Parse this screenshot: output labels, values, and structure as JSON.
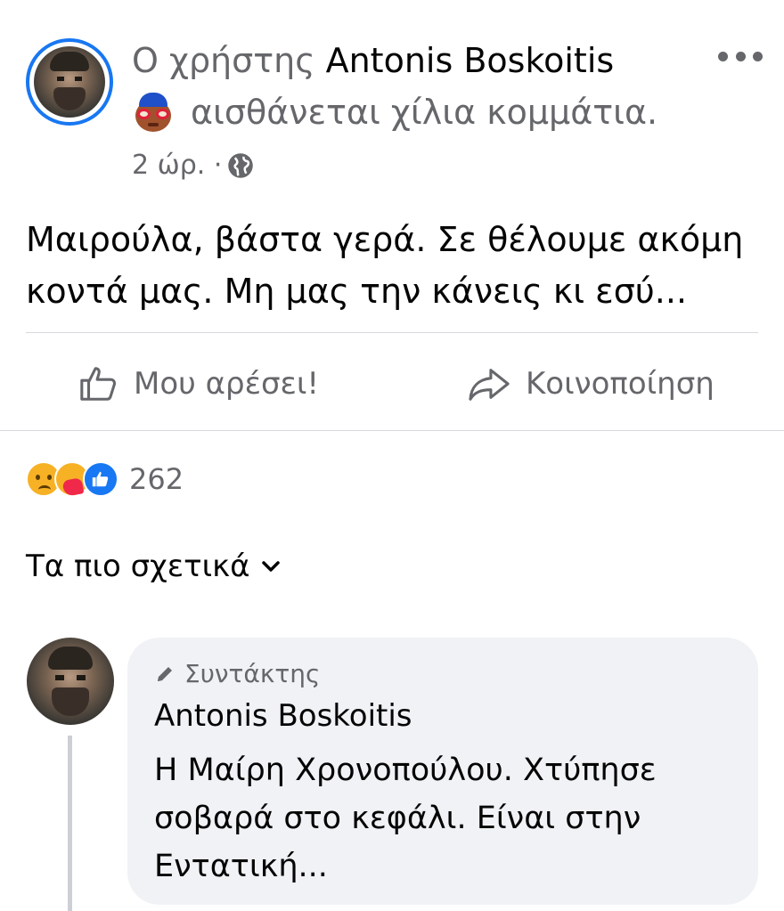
{
  "post": {
    "status_prefix": "Ο χρήστης",
    "author": "Antonis Boskoitis",
    "feeling_emoji": "nerd-with-cap-emoji",
    "feeling_text": "αισθάνεται χίλια κομμάτια.",
    "time": "2 ώρ. ·",
    "privacy_icon": "globe-icon",
    "text": "Μαιρούλα, βάστα γερά. Σε θέλουμε ακόμη κοντά μας. Μη μας την κάνεις κι εσύ..."
  },
  "actions": {
    "like_label": "Μου αρέσει!",
    "share_label": "Κοινοποίηση"
  },
  "reactions": {
    "types": [
      "sad",
      "care",
      "like"
    ],
    "count": "262"
  },
  "sort": {
    "label": "Τα πιο σχετικά"
  },
  "comment": {
    "badge": "Συντάκτης",
    "author": "Antonis Boskoitis",
    "text": "Η Μαίρη Χρονοπούλου. Χτύπησε σοβαρά στο κεφάλι. Είναι στην Εντατική..."
  },
  "colors": {
    "accent": "#1877f2",
    "secondary_text": "#65676b",
    "bubble": "#f0f2f5"
  }
}
